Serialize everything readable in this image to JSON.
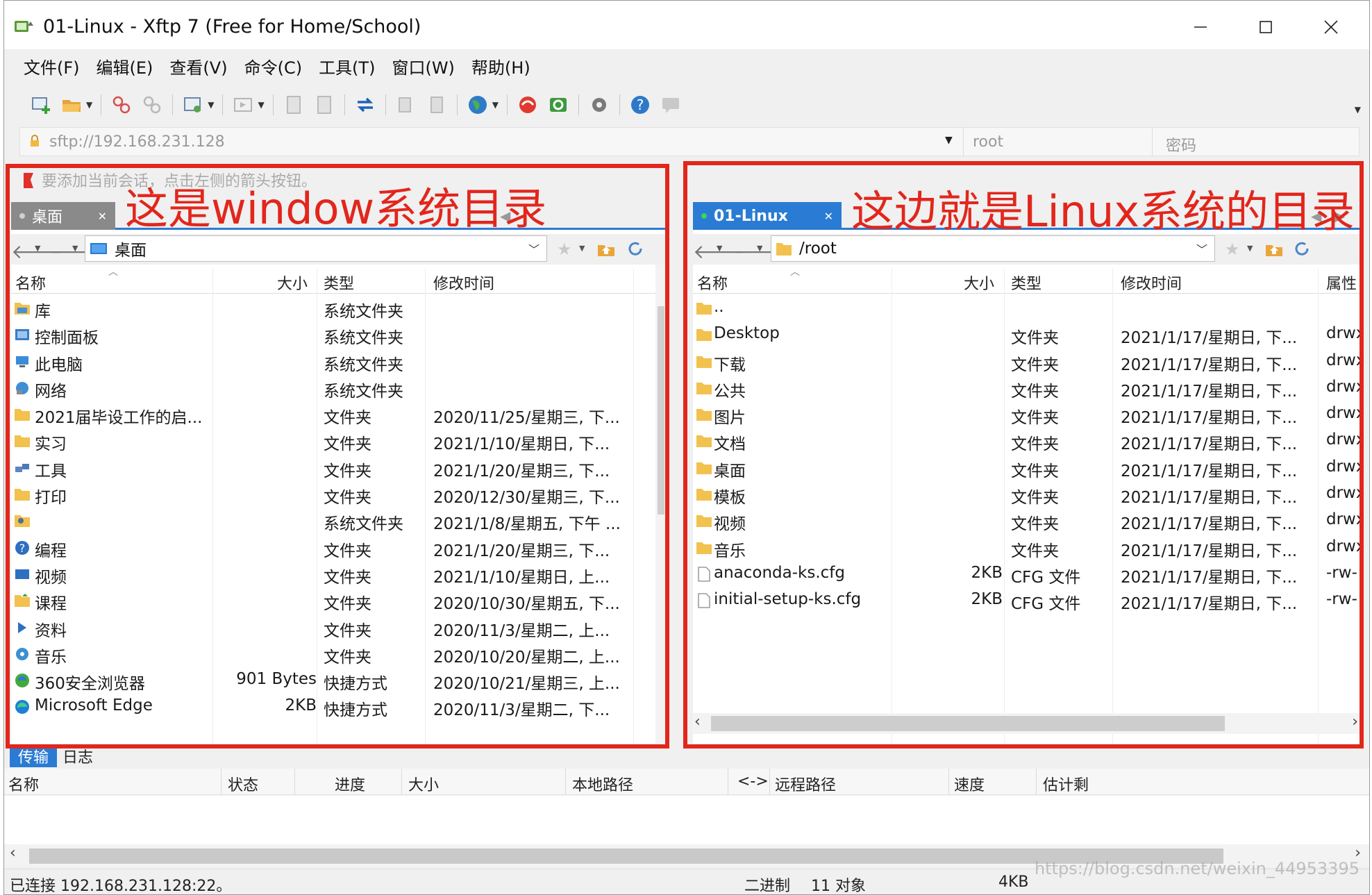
{
  "window": {
    "title": "01-Linux - Xftp 7 (Free for Home/School)",
    "controls": {
      "minimize": "─",
      "maximize": "☐",
      "close": "✕"
    }
  },
  "menu": [
    "文件(F)",
    "编辑(E)",
    "查看(V)",
    "命令(C)",
    "工具(T)",
    "窗口(W)",
    "帮助(H)"
  ],
  "address": {
    "url_placeholder": "sftp://192.168.231.128",
    "user_placeholder": "root",
    "password_placeholder": "密码"
  },
  "hint": "要添加当前会话，点击左侧的箭头按钮。",
  "left_pane": {
    "tab_label": "桌面",
    "path": "桌面",
    "annotation": "这是window系统目录",
    "columns": {
      "name": "名称",
      "size": "大小",
      "type": "类型",
      "modified": "修改时间"
    },
    "rows": [
      {
        "icon": "library-icon",
        "name": "库",
        "size": "",
        "type": "系统文件夹",
        "modified": ""
      },
      {
        "icon": "control-panel-icon",
        "name": "控制面板",
        "size": "",
        "type": "系统文件夹",
        "modified": ""
      },
      {
        "icon": "this-pc-icon",
        "name": "此电脑",
        "size": "",
        "type": "系统文件夹",
        "modified": ""
      },
      {
        "icon": "network-icon",
        "name": "网络",
        "size": "",
        "type": "系统文件夹",
        "modified": ""
      },
      {
        "icon": "folder-icon",
        "name": "2021届毕设工作的启...",
        "size": "",
        "type": "文件夹",
        "modified": "2020/11/25/星期三, 下..."
      },
      {
        "icon": "folder-icon",
        "name": "实习",
        "size": "",
        "type": "文件夹",
        "modified": "2021/1/10/星期日, 下..."
      },
      {
        "icon": "tools-folder-icon",
        "name": "工具",
        "size": "",
        "type": "文件夹",
        "modified": "2021/1/20/星期三, 下..."
      },
      {
        "icon": "folder-icon",
        "name": "打印",
        "size": "",
        "type": "文件夹",
        "modified": "2020/12/30/星期三, 下..."
      },
      {
        "icon": "user-folder-icon",
        "name": "",
        "size": "",
        "type": "系统文件夹",
        "modified": "2021/1/8/星期五, 下午 ..."
      },
      {
        "icon": "help-folder-icon",
        "name": "编程",
        "size": "",
        "type": "文件夹",
        "modified": "2021/1/20/星期三, 下..."
      },
      {
        "icon": "video-folder-icon",
        "name": "视频",
        "size": "",
        "type": "文件夹",
        "modified": "2021/1/10/星期日, 上..."
      },
      {
        "icon": "course-folder-icon",
        "name": "课程",
        "size": "",
        "type": "文件夹",
        "modified": "2020/10/30/星期五, 下..."
      },
      {
        "icon": "play-folder-icon",
        "name": "资料",
        "size": "",
        "type": "文件夹",
        "modified": "2020/11/3/星期二, 上..."
      },
      {
        "icon": "music-folder-icon",
        "name": "音乐",
        "size": "",
        "type": "文件夹",
        "modified": "2020/10/20/星期二, 上..."
      },
      {
        "icon": "browser-shortcut-icon",
        "name": "360安全浏览器",
        "size": "901 Bytes",
        "type": "快捷方式",
        "modified": "2020/10/21/星期三, 上..."
      },
      {
        "icon": "edge-shortcut-icon",
        "name": "Microsoft Edge",
        "size": "2KB",
        "type": "快捷方式",
        "modified": "2020/11/3/星期二, 下..."
      }
    ]
  },
  "right_pane": {
    "tab_label": "01-Linux",
    "path": "/root",
    "annotation": "这边就是Linux系统的目录",
    "columns": {
      "name": "名称",
      "size": "大小",
      "type": "类型",
      "modified": "修改时间",
      "attr": "属性"
    },
    "rows": [
      {
        "icon": "folder-icon",
        "name": "..",
        "size": "",
        "type": "",
        "modified": "",
        "attr": ""
      },
      {
        "icon": "folder-icon",
        "name": "Desktop",
        "size": "",
        "type": "文件夹",
        "modified": "2021/1/17/星期日, 下...",
        "attr": "drwx"
      },
      {
        "icon": "folder-icon",
        "name": "下载",
        "size": "",
        "type": "文件夹",
        "modified": "2021/1/17/星期日, 下...",
        "attr": "drwx"
      },
      {
        "icon": "folder-icon",
        "name": "公共",
        "size": "",
        "type": "文件夹",
        "modified": "2021/1/17/星期日, 下...",
        "attr": "drwx"
      },
      {
        "icon": "folder-icon",
        "name": "图片",
        "size": "",
        "type": "文件夹",
        "modified": "2021/1/17/星期日, 下...",
        "attr": "drwx"
      },
      {
        "icon": "folder-icon",
        "name": "文档",
        "size": "",
        "type": "文件夹",
        "modified": "2021/1/17/星期日, 下...",
        "attr": "drwx"
      },
      {
        "icon": "folder-icon",
        "name": "桌面",
        "size": "",
        "type": "文件夹",
        "modified": "2021/1/17/星期日, 下...",
        "attr": "drwx"
      },
      {
        "icon": "folder-icon",
        "name": "模板",
        "size": "",
        "type": "文件夹",
        "modified": "2021/1/17/星期日, 下...",
        "attr": "drwx"
      },
      {
        "icon": "folder-icon",
        "name": "视频",
        "size": "",
        "type": "文件夹",
        "modified": "2021/1/17/星期日, 下...",
        "attr": "drwx"
      },
      {
        "icon": "folder-icon",
        "name": "音乐",
        "size": "",
        "type": "文件夹",
        "modified": "2021/1/17/星期日, 下...",
        "attr": "drwx"
      },
      {
        "icon": "file-icon",
        "name": "anaconda-ks.cfg",
        "size": "2KB",
        "type": "CFG 文件",
        "modified": "2021/1/17/星期日, 下...",
        "attr": "-rw-"
      },
      {
        "icon": "file-icon",
        "name": "initial-setup-ks.cfg",
        "size": "2KB",
        "type": "CFG 文件",
        "modified": "2021/1/17/星期日, 下...",
        "attr": "-rw-"
      }
    ]
  },
  "transfer": {
    "tabs": [
      "传输",
      "日志"
    ],
    "columns": [
      "名称",
      "状态",
      "进度",
      "大小",
      "本地路径",
      "<->",
      "远程路径",
      "速度",
      "估计剩"
    ]
  },
  "status": {
    "connected": "已连接 192.168.231.128:22。",
    "mode": "二进制",
    "count": "11 对象",
    "size": "4KB"
  },
  "watermark": "https://blog.csdn.net/weixin_44953395"
}
